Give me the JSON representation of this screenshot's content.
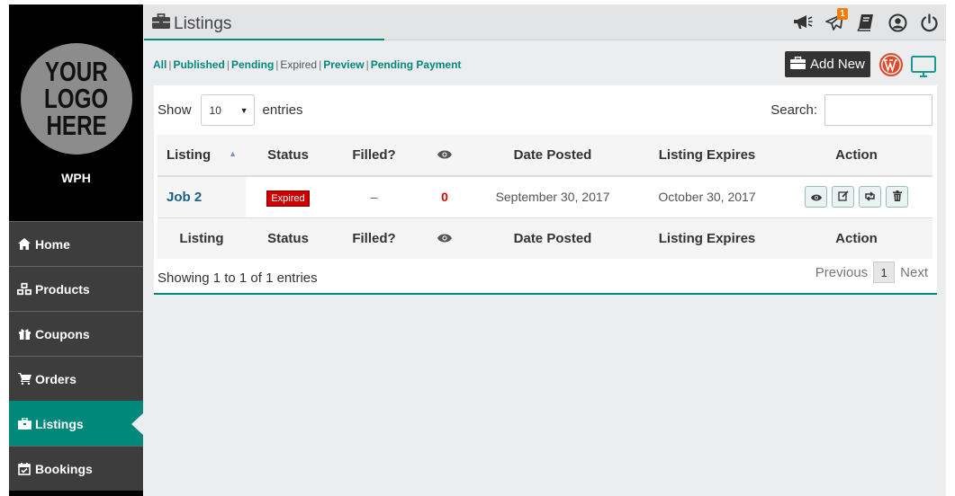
{
  "sidebar": {
    "logo_lines": [
      "YOUR",
      "LOGO",
      "HERE"
    ],
    "site_name": "WPH",
    "items": [
      {
        "label": "Home",
        "icon": "home-icon"
      },
      {
        "label": "Products",
        "icon": "cubes-icon"
      },
      {
        "label": "Coupons",
        "icon": "gift-icon"
      },
      {
        "label": "Orders",
        "icon": "cart-icon"
      },
      {
        "label": "Listings",
        "icon": "briefcase-icon",
        "active": true
      },
      {
        "label": "Bookings",
        "icon": "calendar-check-icon"
      }
    ]
  },
  "header": {
    "title": "Listings",
    "notification_count": "1",
    "icons": [
      "megaphone-icon",
      "paper-plane-icon",
      "book-icon",
      "user-circle-icon",
      "power-icon"
    ]
  },
  "filters": {
    "all": "All",
    "published": "Published",
    "pending": "Pending",
    "expired": "Expired",
    "preview": "Preview",
    "pending_payment": "Pending Payment",
    "separator": "|"
  },
  "toolbar": {
    "add_new": "Add New"
  },
  "table_controls": {
    "show_label": "Show",
    "entries_value": "10",
    "entries_label": "entries",
    "search_label": "Search:"
  },
  "table": {
    "columns": [
      "Listing",
      "Status",
      "Filled?",
      "views-icon",
      "Date Posted",
      "Listing Expires",
      "Action"
    ],
    "rows": [
      {
        "listing": "Job 2",
        "status": "Expired",
        "filled": "–",
        "views": "0",
        "date_posted": "September 30, 2017",
        "expires": "October 30, 2017"
      }
    ]
  },
  "footer": {
    "info": "Showing 1 to 1 of 1 entries",
    "previous": "Previous",
    "page": "1",
    "next": "Next"
  },
  "colors": {
    "accent": "#00897b",
    "sidebar_bg": "#3d3d3d",
    "expired_badge": "#cc0000"
  }
}
